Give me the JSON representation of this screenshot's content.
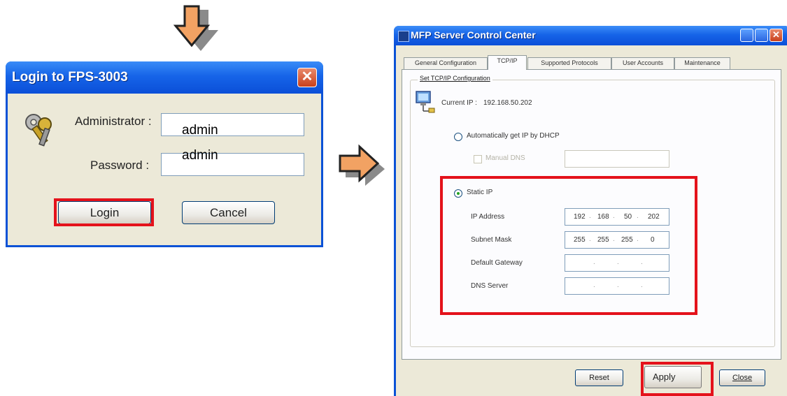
{
  "login_dialog": {
    "title": "Login to FPS-3003",
    "close_glyph": "✕",
    "administrator_label": "Administrator :",
    "password_label": "Password :",
    "administrator_value": "admin",
    "password_value": "admin",
    "login_button": "Login",
    "cancel_button": "Cancel"
  },
  "server_window": {
    "title": "MFP Server Control Center",
    "close_glyph": "✕",
    "tabs": [
      {
        "label": "General Configuration",
        "active": false
      },
      {
        "label": "TCP/IP",
        "active": true
      },
      {
        "label": "Supported Protocols",
        "active": false
      },
      {
        "label": "User Accounts",
        "active": false
      },
      {
        "label": "Maintenance",
        "active": false
      }
    ],
    "group_title": "Set TCP/IP Configuration",
    "current_ip_label": "Current IP :",
    "current_ip_value": "192.168.50.202",
    "dhcp_option": "Automatically get IP by DHCP",
    "manual_dns_label": "Manual DNS",
    "static_ip_option": "Static IP",
    "fields": {
      "ip_address": {
        "label": "IP Address",
        "octets": [
          "192",
          "168",
          "50",
          "202"
        ]
      },
      "subnet_mask": {
        "label": "Subnet Mask",
        "octets": [
          "255",
          "255",
          "255",
          "0"
        ]
      },
      "default_gateway": {
        "label": "Default Gateway",
        "octets": [
          "",
          "",
          "",
          ""
        ]
      },
      "dns_server": {
        "label": "DNS Server",
        "octets": [
          "",
          "",
          "",
          ""
        ]
      }
    },
    "buttons": {
      "reset": "Reset",
      "apply": "Apply",
      "close": "Close"
    }
  },
  "colors": {
    "highlight": "#e4121b",
    "arrow_fill": "#f2a263",
    "xp_titlebar": "#1664e8",
    "dialog_face": "#ece9d8"
  },
  "icons": [
    "keys-icon",
    "network-computer-icon",
    "arrow-down-icon",
    "arrow-right-icon"
  ]
}
